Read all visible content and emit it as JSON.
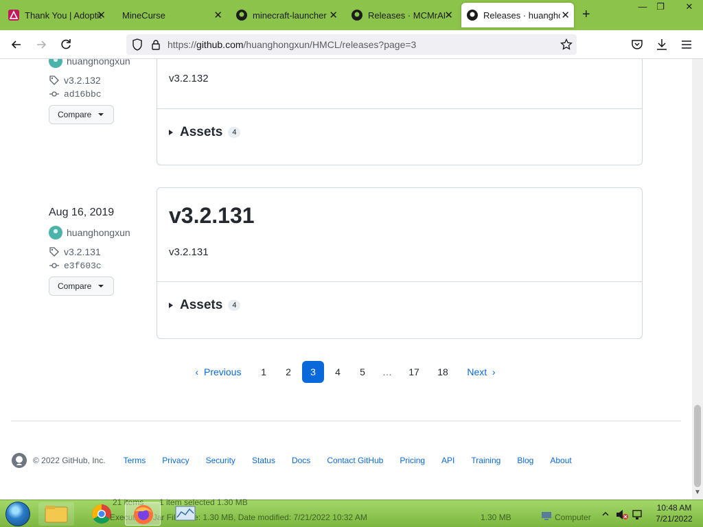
{
  "browser": {
    "tabs": [
      {
        "title": "Thank You | Adoptium",
        "icon": "adoptium-icon"
      },
      {
        "title": "MineCurse",
        "icon": "blank-page-icon"
      },
      {
        "title": "minecraft-launcher · GitHub",
        "icon": "github-icon"
      },
      {
        "title": "Releases · MCMrARM",
        "icon": "github-icon"
      },
      {
        "title": "Releases · huanghongxun",
        "icon": "github-icon",
        "active": true
      }
    ],
    "url_prefix": "https://",
    "url_domain": "github.com",
    "url_path": "/huanghongxun/HMCL/releases?page=3"
  },
  "releases": [
    {
      "author": "huanghongxun",
      "tag": "v3.2.132",
      "commit": "ad16bbc",
      "compare_label": "Compare",
      "body": "v3.2.132",
      "assets_label": "Assets",
      "assets_count": "4"
    },
    {
      "date": "Aug 16, 2019",
      "author": "huanghongxun",
      "tag": "v3.2.131",
      "commit": "e3f603c",
      "compare_label": "Compare",
      "title": "v3.2.131",
      "body": "v3.2.131",
      "assets_label": "Assets",
      "assets_count": "4"
    }
  ],
  "pagination": {
    "previous": "Previous",
    "pages": [
      "1",
      "2",
      "3",
      "4",
      "5",
      "…",
      "17",
      "18"
    ],
    "current": "3",
    "next": "Next"
  },
  "footer": {
    "copyright": "© 2022 GitHub, Inc.",
    "links": [
      "Terms",
      "Privacy",
      "Security",
      "Status",
      "Docs",
      "Contact GitHub",
      "Pricing",
      "API",
      "Training",
      "Blog",
      "About"
    ]
  },
  "taskbar": {
    "status_items": "21 items",
    "status_selected": "1 item selected  1.30 MB",
    "status_file": "Executable Jar File  Size: 1.30 MB, Date modified: 7/21/2022 10:32 AM",
    "status_size": "1.30 MB",
    "status_location": "Computer",
    "time": "10:48 AM",
    "date": "7/21/2022"
  }
}
